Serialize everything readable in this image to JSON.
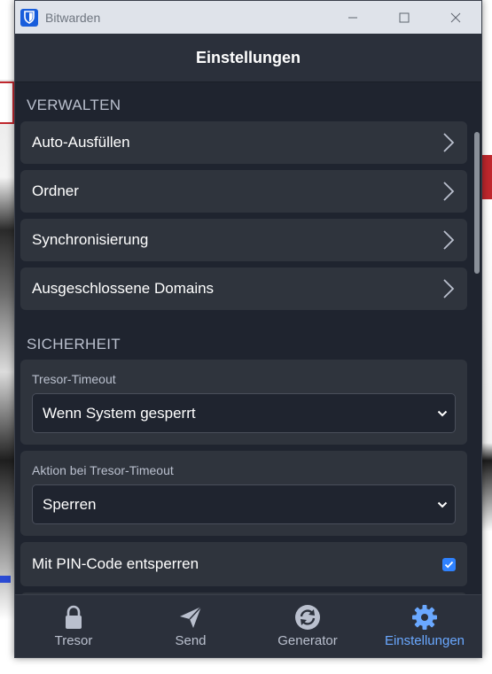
{
  "window": {
    "app_title": "Bitwarden",
    "header_title": "Einstellungen"
  },
  "sections": {
    "manage": {
      "title": "VERWALTEN",
      "items": [
        {
          "label": "Auto-Ausfüllen"
        },
        {
          "label": "Ordner"
        },
        {
          "label": "Synchronisierung"
        },
        {
          "label": "Ausgeschlossene Domains"
        }
      ]
    },
    "security": {
      "title": "SICHERHEIT",
      "vault_timeout": {
        "label": "Tresor-Timeout",
        "value": "Wenn System gesperrt"
      },
      "timeout_action": {
        "label": "Aktion bei Tresor-Timeout",
        "value": "Sperren"
      },
      "pin_unlock": {
        "label": "Mit PIN-Code entsperren",
        "checked": true
      }
    }
  },
  "tabs": [
    {
      "label": "Tresor",
      "icon": "lock-icon",
      "active": false
    },
    {
      "label": "Send",
      "icon": "paper-plane-icon",
      "active": false
    },
    {
      "label": "Generator",
      "icon": "refresh-icon",
      "active": false
    },
    {
      "label": "Einstellungen",
      "icon": "gear-icon",
      "active": true
    }
  ],
  "colors": {
    "accent": "#175ddc",
    "active_tab": "#6aa8ff",
    "background": "#1f242f",
    "card": "#2f343d",
    "checkbox": "#2f82ff"
  }
}
